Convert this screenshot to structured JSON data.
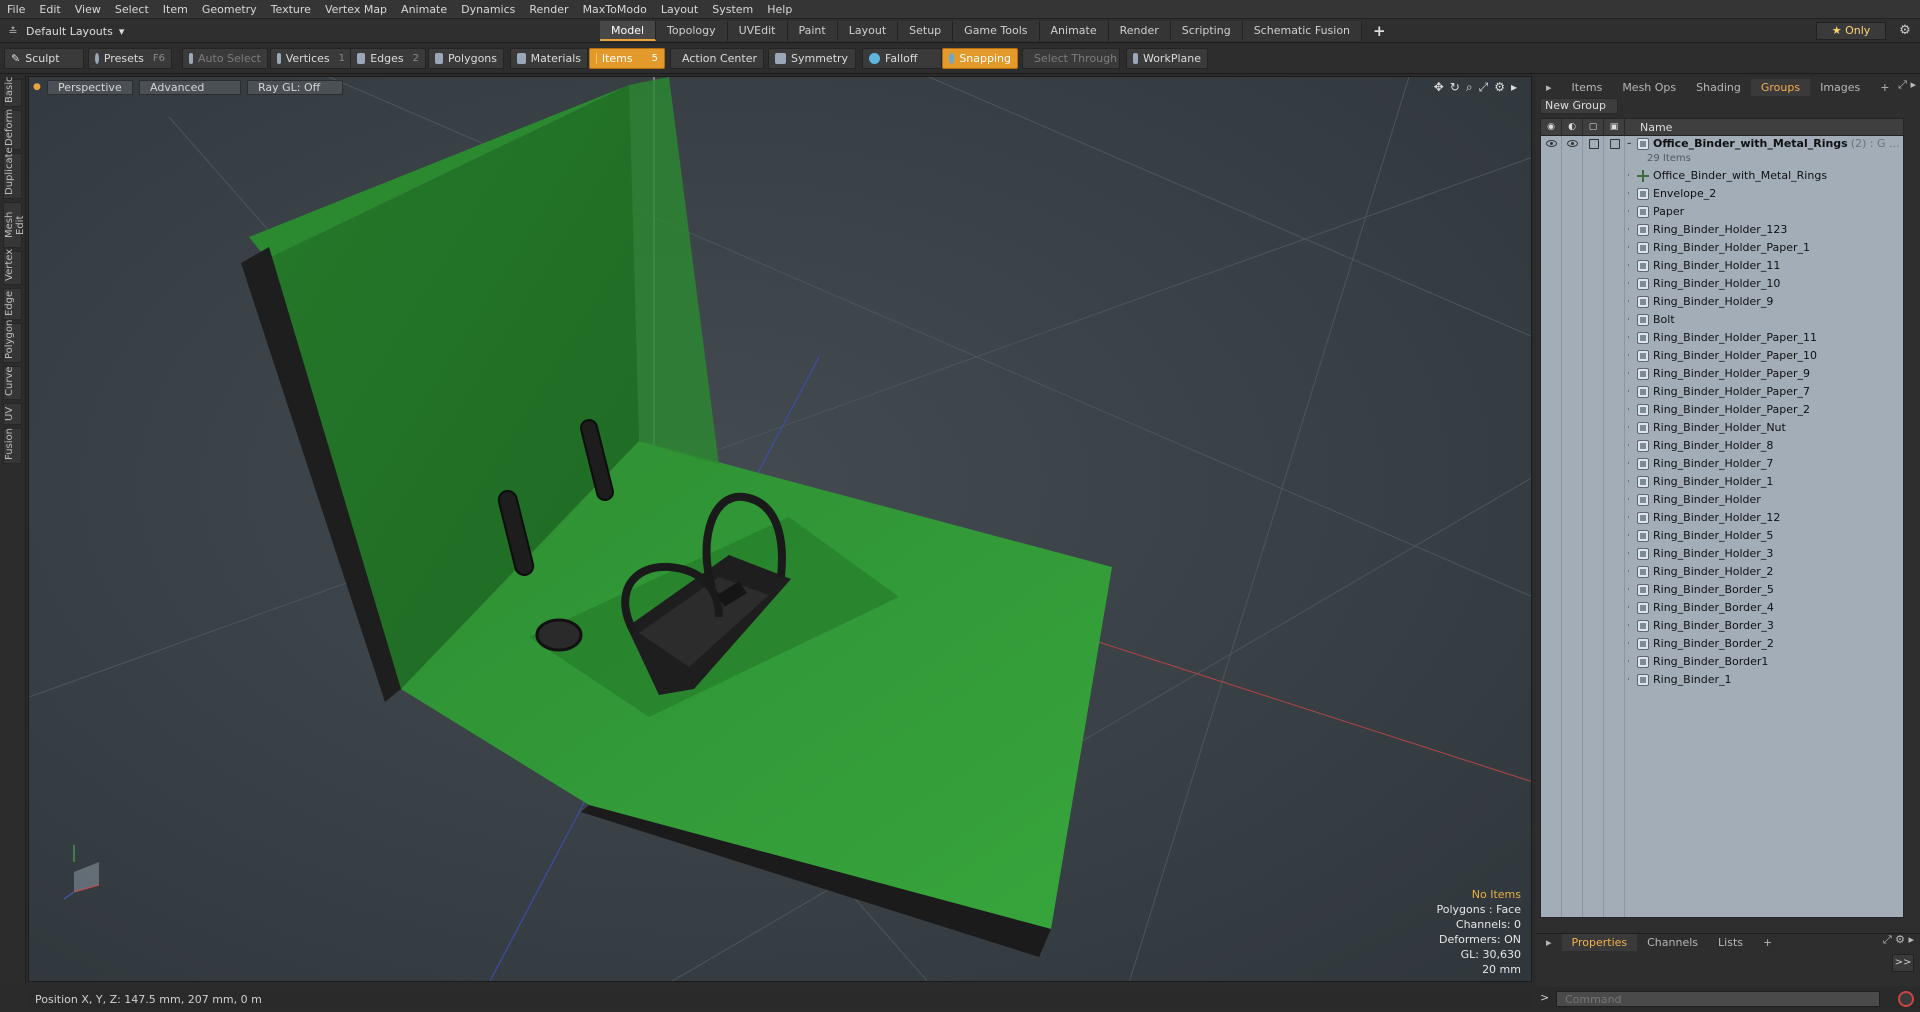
{
  "menu": [
    "File",
    "Edit",
    "View",
    "Select",
    "Item",
    "Geometry",
    "Texture",
    "Vertex Map",
    "Animate",
    "Dynamics",
    "Render",
    "MaxToModo",
    "Layout",
    "System",
    "Help"
  ],
  "layout_selector": "Default Layouts",
  "layout_tabs": [
    "Model",
    "Topology",
    "UVEdit",
    "Paint",
    "Layout",
    "Setup",
    "Game Tools",
    "Animate",
    "Render",
    "Scripting",
    "Schematic Fusion"
  ],
  "only_label": "Only",
  "toolbar": {
    "sculpt": "Sculpt",
    "presets": "Presets",
    "presets_key": "F6",
    "auto_select": "Auto Select",
    "vertices": "Vertices",
    "vertices_key": "1",
    "edges": "Edges",
    "edges_key": "2",
    "polygons": "Polygons",
    "materials": "Materials",
    "items": "Items",
    "items_key": "5",
    "action_center": "Action Center",
    "symmetry": "Symmetry",
    "falloff": "Falloff",
    "snapping": "Snapping",
    "select_through": "Select Through",
    "workplane": "WorkPlane"
  },
  "left_tabs": [
    "Basic",
    "Deform",
    "Duplicate",
    "Mesh Edit",
    "Vertex",
    "Edge",
    "Polygon",
    "Curve",
    "UV",
    "Fusion"
  ],
  "viewport": {
    "view_mode": "Perspective",
    "shading": "Advanced",
    "raygl": "Ray GL: Off",
    "info": {
      "no_items": "No Items",
      "polygons": "Polygons : Face",
      "channels": "Channels: 0",
      "deformers": "Deformers: ON",
      "gl": "GL: 30,630",
      "scale": "20 mm"
    }
  },
  "status_bar": "Position X, Y, Z:   147.5 mm, 207 mm, 0 m",
  "right_panel": {
    "tabs": [
      "Items",
      "Mesh Ops",
      "Shading",
      "Groups",
      "Images"
    ],
    "active_tab": "Groups",
    "new_group": "New Group",
    "name_header": "Name",
    "group": {
      "name": "Office_Binder_with_Metal_Rings",
      "suffix": "(2) : G ...",
      "count": "29 Items"
    },
    "items": [
      {
        "name": "Office_Binder_with_Metal_Rings",
        "type": "locator"
      },
      {
        "name": "Envelope_2",
        "type": "mesh"
      },
      {
        "name": "Paper",
        "type": "mesh"
      },
      {
        "name": "Ring_Binder_Holder_123",
        "type": "mesh"
      },
      {
        "name": "Ring_Binder_Holder_Paper_1",
        "type": "mesh"
      },
      {
        "name": "Ring_Binder_Holder_11",
        "type": "mesh"
      },
      {
        "name": "Ring_Binder_Holder_10",
        "type": "mesh"
      },
      {
        "name": "Ring_Binder_Holder_9",
        "type": "mesh"
      },
      {
        "name": "Bolt",
        "type": "mesh"
      },
      {
        "name": "Ring_Binder_Holder_Paper_11",
        "type": "mesh"
      },
      {
        "name": "Ring_Binder_Holder_Paper_10",
        "type": "mesh"
      },
      {
        "name": "Ring_Binder_Holder_Paper_9",
        "type": "mesh"
      },
      {
        "name": "Ring_Binder_Holder_Paper_7",
        "type": "mesh"
      },
      {
        "name": "Ring_Binder_Holder_Paper_2",
        "type": "mesh"
      },
      {
        "name": "Ring_Binder_Holder_Nut",
        "type": "mesh"
      },
      {
        "name": "Ring_Binder_Holder_8",
        "type": "mesh"
      },
      {
        "name": "Ring_Binder_Holder_7",
        "type": "mesh"
      },
      {
        "name": "Ring_Binder_Holder_1",
        "type": "mesh"
      },
      {
        "name": "Ring_Binder_Holder",
        "type": "mesh"
      },
      {
        "name": "Ring_Binder_Holder_12",
        "type": "mesh"
      },
      {
        "name": "Ring_Binder_Holder_5",
        "type": "mesh"
      },
      {
        "name": "Ring_Binder_Holder_3",
        "type": "mesh"
      },
      {
        "name": "Ring_Binder_Holder_2",
        "type": "mesh"
      },
      {
        "name": "Ring_Binder_Border_5",
        "type": "mesh"
      },
      {
        "name": "Ring_Binder_Border_4",
        "type": "mesh"
      },
      {
        "name": "Ring_Binder_Border_3",
        "type": "mesh"
      },
      {
        "name": "Ring_Binder_Border_2",
        "type": "mesh"
      },
      {
        "name": "Ring_Binder_Border1",
        "type": "mesh"
      },
      {
        "name": "Ring_Binder_1",
        "type": "mesh"
      }
    ],
    "bottom_tabs": [
      "Properties",
      "Channels",
      "Lists"
    ],
    "bottom_active": "Properties",
    "expand_label": ">>",
    "command_placeholder": "Command"
  },
  "colors": {
    "accent": "#e8a33d",
    "binder_green": "#2f8f2f",
    "viewport_bg": "#3a4146",
    "tree_bg": "#a2adb8"
  }
}
